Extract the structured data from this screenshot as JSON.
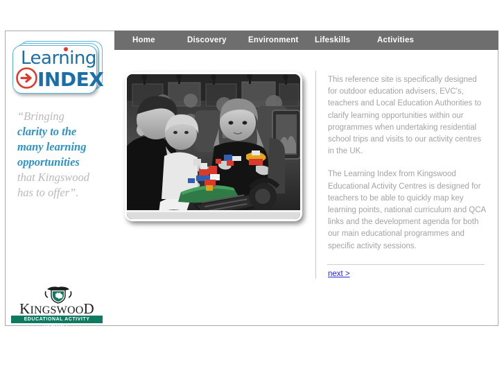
{
  "nav": {
    "items": [
      {
        "label": "Home"
      },
      {
        "label": "Discovery"
      },
      {
        "label": "Environment"
      },
      {
        "label": "Lifeskills"
      },
      {
        "label": "Activities"
      }
    ]
  },
  "logo": {
    "word_top": "Learning",
    "word_bottom": "INDEX",
    "arrow_icon": "arrow-right-circle-icon",
    "accent_blue": "#1a6fa8",
    "accent_red": "#e03a2f",
    "outline_blue": "#57b4dd"
  },
  "quote": {
    "line1_grey": "“Bringing",
    "line2_blue": "clarity to the",
    "line3_blue": "many learning",
    "line4_blue": "opportunities",
    "line5_grey": "that Kingswood",
    "line6_grey": "has to offer”.",
    "grey_color": "#b9b9b9",
    "blue_color": "#2f93c8"
  },
  "photo": {
    "alt": "teacher and schoolchildren building coloured LEGO models at computer workstations",
    "style": "black-and-white photograph with selective colour"
  },
  "copy": {
    "paragraph1": "This reference site is specifically designed for outdoor education advisers, EVC's, teachers and Local Education Authorities to clarify learning opportunities within our programmes when undertaking residential school trips and visits to our activity centres in the UK.",
    "paragraph2": "The Learning Index from Kingswood Educational Activity Centres is designed for teachers to be able to quickly map key learning points, national curriculum and QCA links and the development agenda for both our main educational programmes and specific activity sessions.",
    "text_color": "#a3a3a3"
  },
  "next": {
    "label": "next >",
    "color": "#2727d6"
  },
  "kingswood": {
    "crest_icon": "heraldic-crest-icon",
    "name_k": "K",
    "name_rest": "INGSWOO",
    "name_d": "D",
    "strapline": "EDUCATIONAL ACTIVITY CENTRES",
    "strap_color": "#0e7a5f"
  },
  "chrome": {
    "navbar_color": "#6e6e6e",
    "page_border_color": "#a9a9a9",
    "divider_color": "#c9c9c9"
  }
}
